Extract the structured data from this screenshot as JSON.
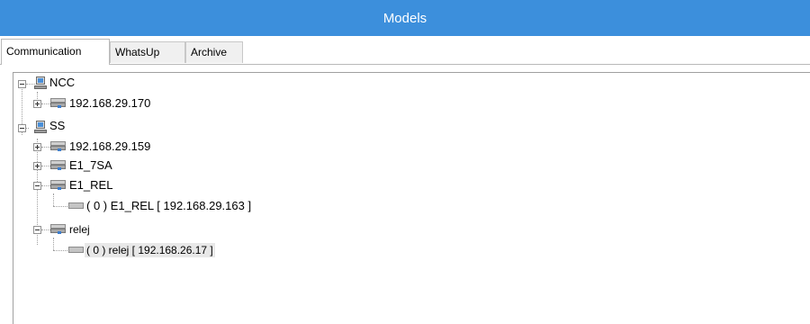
{
  "window": {
    "title": "Models"
  },
  "tabs": [
    {
      "label": "Communication",
      "active": true
    },
    {
      "label": "WhatsUp",
      "active": false
    },
    {
      "label": "Archive",
      "active": false
    }
  ],
  "tree": {
    "nodes": [
      {
        "label": "NCC",
        "icon": "network-station-icon",
        "expanded": true
      },
      {
        "label": "192.168.29.170",
        "icon": "device-icon",
        "expanded": false
      },
      {
        "label": "SS",
        "icon": "network-station-icon",
        "expanded": true
      },
      {
        "label": "192.168.29.159",
        "icon": "device-icon",
        "expanded": false
      },
      {
        "label": "E1_7SA",
        "icon": "device-icon",
        "expanded": false
      },
      {
        "label": "E1_REL",
        "icon": "device-icon",
        "expanded": true
      },
      {
        "label": "( 0 ) E1_REL [ 192.168.29.163 ]",
        "icon": "connection-icon"
      },
      {
        "label": "relej",
        "icon": "device-icon",
        "expanded": true
      },
      {
        "label": "( 0 ) relej [ 192.168.26.17 ]",
        "icon": "connection-icon",
        "selected": true
      }
    ]
  }
}
